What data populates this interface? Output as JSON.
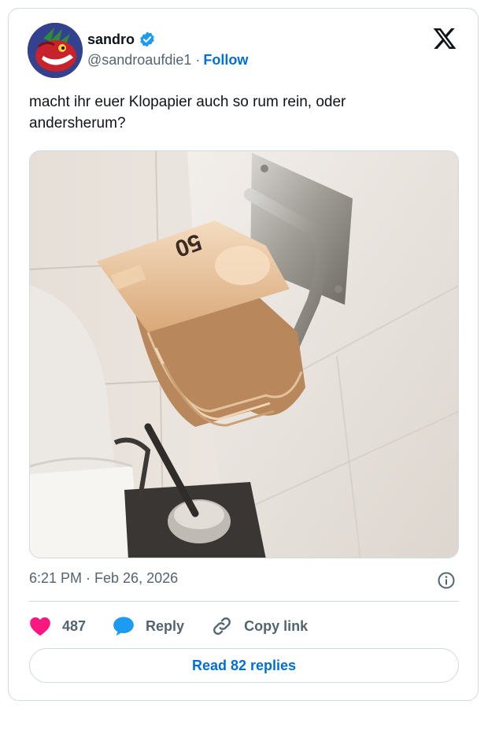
{
  "author": {
    "name": "sandro",
    "handle": "@sandroaufdie1",
    "separator": "·",
    "follow_label": "Follow",
    "verified": true,
    "avatar_icon": "dragon-avatar-icon"
  },
  "tweet": {
    "text": "macht ihr euer Klopapier auch so rum rein, oder andersherum?",
    "timestamp": "6:21 PM · Feb 26, 2026",
    "photo_banknote_text": "50"
  },
  "actions": {
    "likes": "487",
    "reply_label": "Reply",
    "copy_label": "Copy link"
  },
  "read_replies_label": "Read 82 replies",
  "colors": {
    "link": "#006fd6",
    "heart": "#f91880",
    "reply_bubble": "#1d9bf0",
    "border": "#cfd9de",
    "secondary_text": "#536471"
  }
}
